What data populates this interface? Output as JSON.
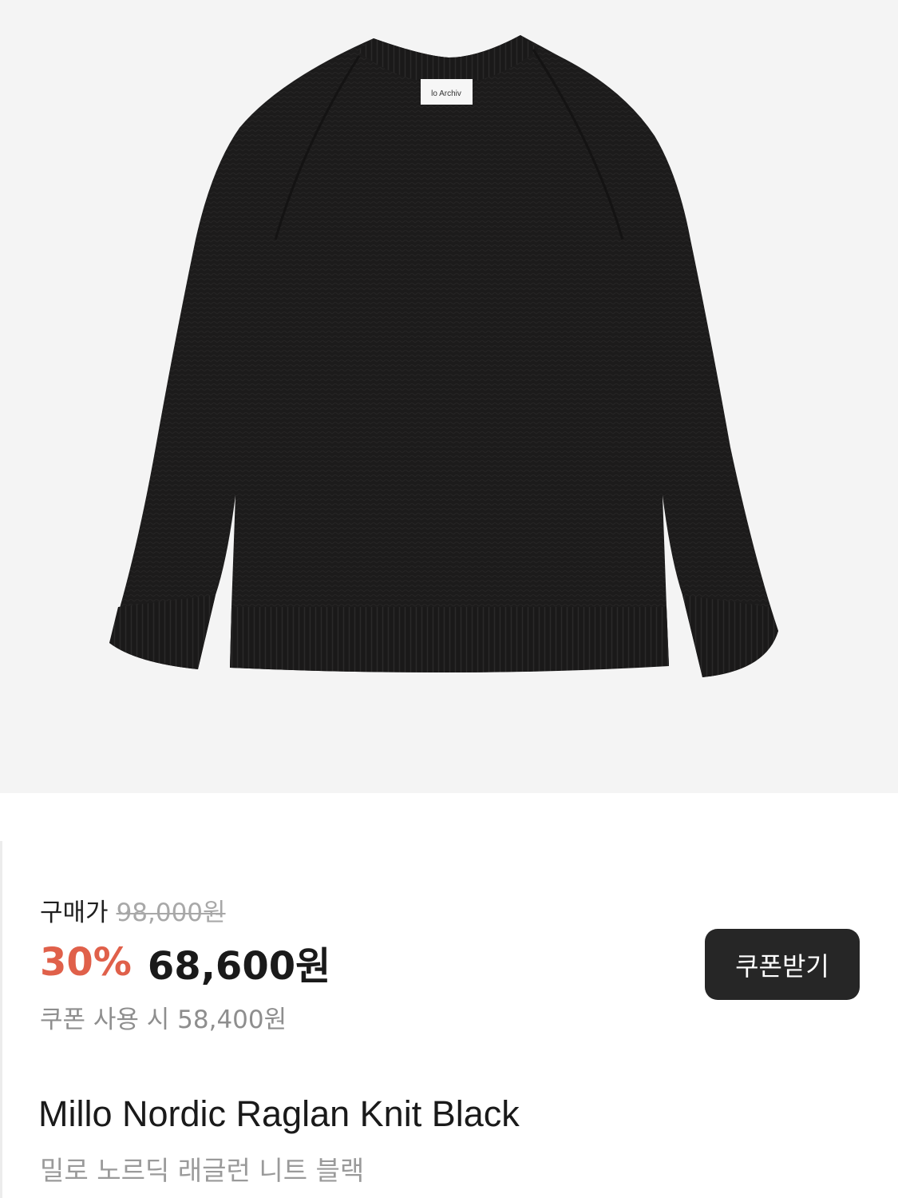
{
  "product": {
    "image_alt": "black knit sweater",
    "label_text": "lo Archiv"
  },
  "pricing": {
    "label": "구매가",
    "original_price": "98,000원",
    "discount": "30%",
    "sale_price": "68,600원",
    "coupon_price": "쿠폰 사용 시 58,400원",
    "coupon_button": "쿠폰받기"
  },
  "title": {
    "name": "Millo Nordic Raglan Knit Black",
    "name_ko": "밀로 노르딕 래글런 니트 블랙"
  },
  "colors": {
    "discount": "#e0604a",
    "button_bg": "#262626",
    "image_bg": "#f4f4f4",
    "sweater": "#1b1a1a"
  }
}
